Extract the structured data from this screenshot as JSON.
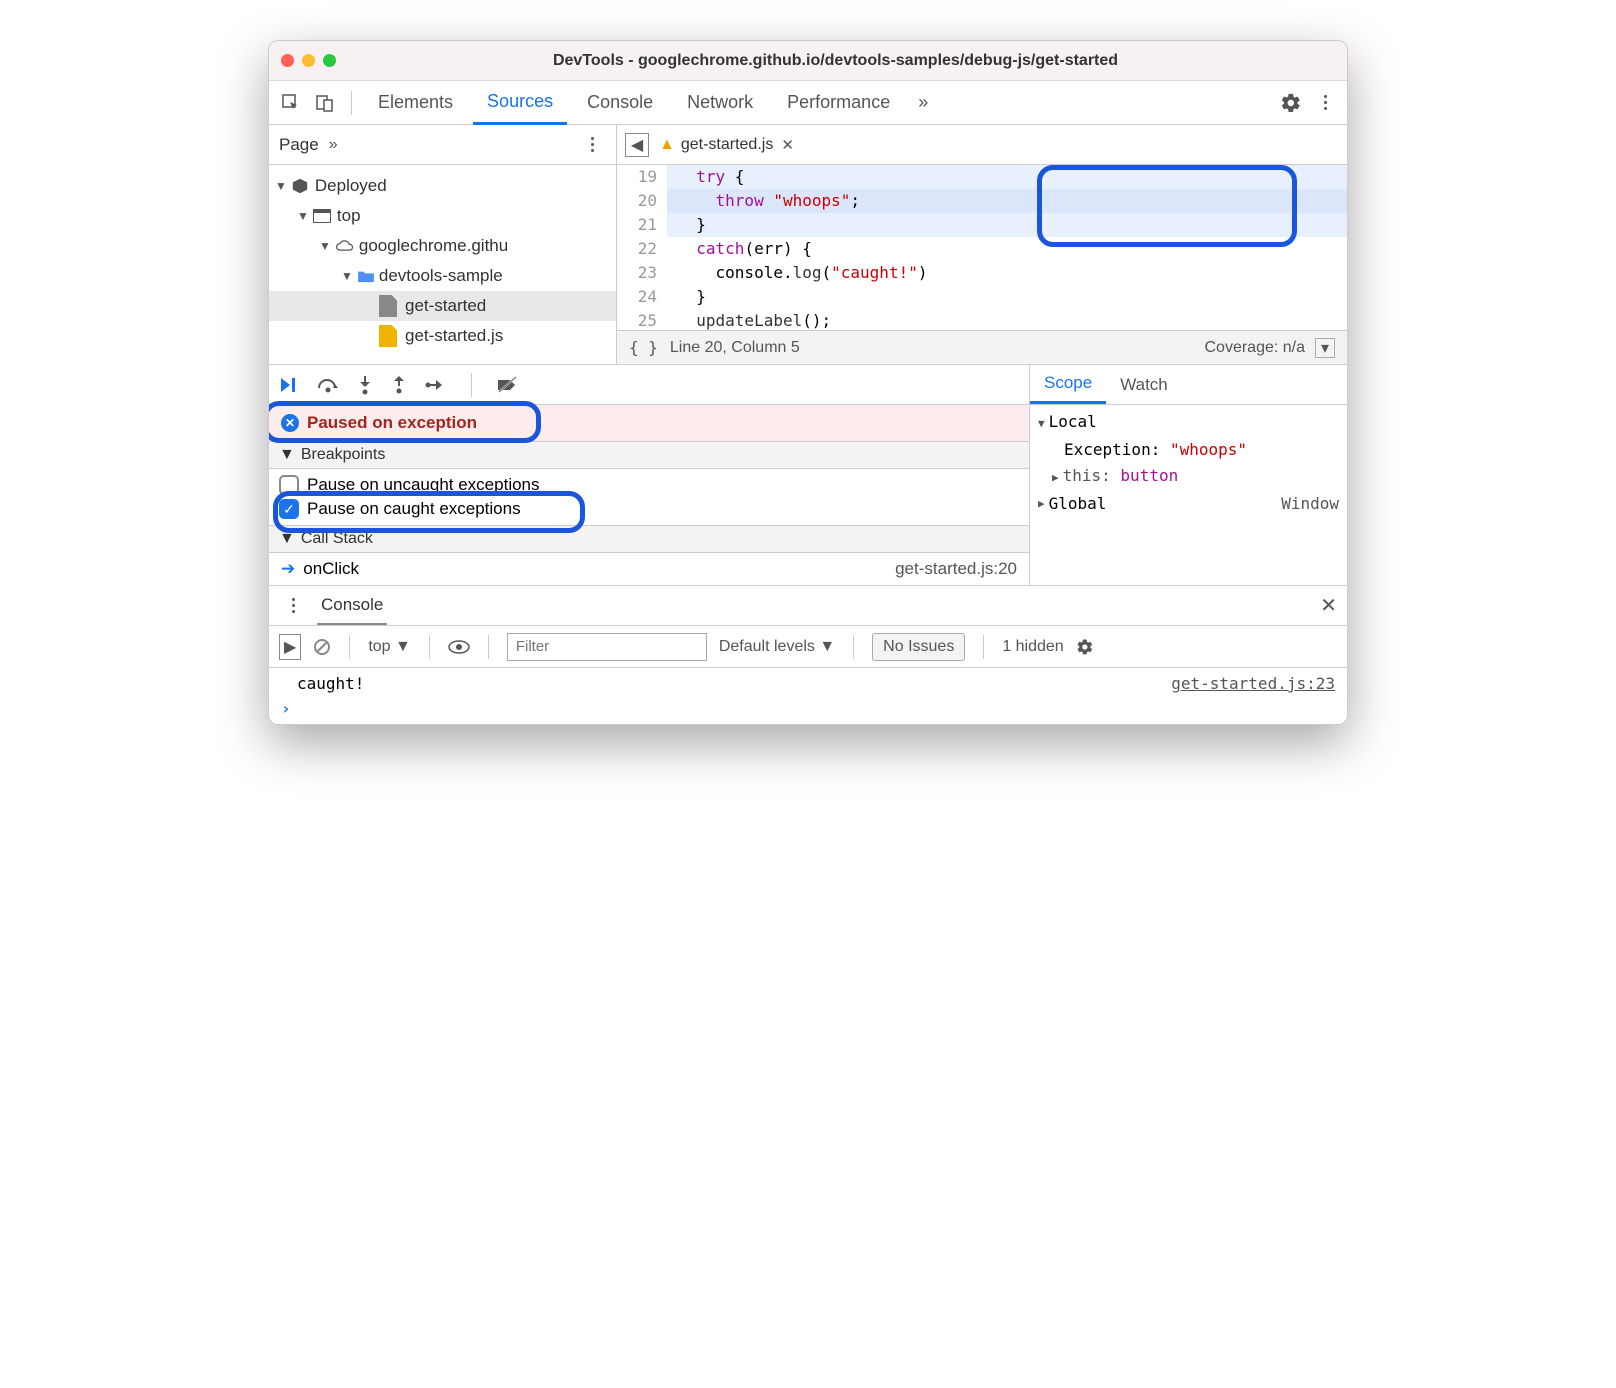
{
  "title": "DevTools - googlechrome.github.io/devtools-samples/debug-js/get-started",
  "tabs": [
    "Elements",
    "Sources",
    "Console",
    "Network",
    "Performance"
  ],
  "active_tab": "Sources",
  "page_panel_label": "Page",
  "file_tab": "get-started.js",
  "tree": {
    "root": "Deployed",
    "top": "top",
    "domain": "googlechrome.githu",
    "folder": "devtools-sample",
    "file1": "get-started",
    "file2": "get-started.js"
  },
  "code": {
    "lines": [
      {
        "n": "19",
        "pad": "  ",
        "t": [
          {
            "k": "kw",
            "v": "try"
          },
          {
            "k": "p",
            "v": " {"
          }
        ]
      },
      {
        "n": "20",
        "pad": "    ",
        "t": [
          {
            "k": "kw",
            "v": "throw"
          },
          {
            "k": "p",
            "v": " "
          },
          {
            "k": "str",
            "v": "\"whoops\""
          },
          {
            "k": "p",
            "v": ";"
          }
        ]
      },
      {
        "n": "21",
        "pad": "  ",
        "t": [
          {
            "k": "p",
            "v": "}"
          }
        ]
      },
      {
        "n": "22",
        "pad": "  ",
        "t": [
          {
            "k": "kw",
            "v": "catch"
          },
          {
            "k": "p",
            "v": "(err) {"
          }
        ]
      },
      {
        "n": "23",
        "pad": "    ",
        "t": [
          {
            "k": "p",
            "v": "console."
          },
          {
            "k": "fn",
            "v": "log"
          },
          {
            "k": "p",
            "v": "("
          },
          {
            "k": "str",
            "v": "\"caught!\""
          },
          {
            "k": "p",
            "v": ")"
          }
        ]
      },
      {
        "n": "24",
        "pad": "  ",
        "t": [
          {
            "k": "p",
            "v": "}"
          }
        ]
      },
      {
        "n": "25",
        "pad": "  ",
        "t": [
          {
            "k": "fn",
            "v": "updateLabel"
          },
          {
            "k": "p",
            "v": "();"
          }
        ]
      }
    ]
  },
  "status": {
    "braces": "{ }",
    "pos": "Line 20, Column 5",
    "coverage": "Coverage: n/a"
  },
  "pause_msg": "Paused on exception",
  "breakpoints": {
    "header": "Breakpoints",
    "opt1": "Pause on uncaught exceptions",
    "opt2": "Pause on caught exceptions"
  },
  "callstack": {
    "header": "Call Stack",
    "frame": "onClick",
    "loc": "get-started.js:20"
  },
  "scope": {
    "tabs": [
      "Scope",
      "Watch"
    ],
    "local": "Local",
    "exception_k": "Exception: ",
    "exception_v": "\"whoops\"",
    "this_k": "this: ",
    "this_v": "button",
    "global_k": "Global",
    "global_v": "Window"
  },
  "console": {
    "tab": "Console",
    "context": "top",
    "filter_ph": "Filter",
    "levels": "Default levels",
    "issues": "No Issues",
    "hidden": "1 hidden",
    "log": "caught!",
    "log_src": "get-started.js:23"
  }
}
